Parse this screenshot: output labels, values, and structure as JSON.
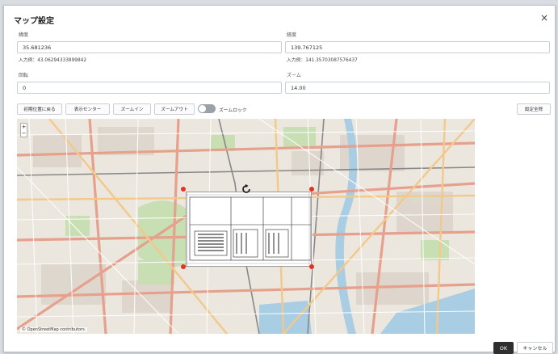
{
  "dialog": {
    "title": "マップ設定",
    "close_label": "×"
  },
  "fields": {
    "latitude": {
      "label": "緯度",
      "value": "35.681236",
      "hint": "入力例：43.06294333899842"
    },
    "longitude": {
      "label": "経度",
      "value": "139.767125",
      "hint": "入力例：141.35703087576437"
    },
    "rotation": {
      "label": "回転",
      "value": "0"
    },
    "zoom": {
      "label": "ズーム",
      "value": "14.00"
    }
  },
  "toolbar": {
    "reset_position": "初期位置に戻る",
    "display_center": "表示センター",
    "zoom_in": "ズームイン",
    "zoom_out": "ズームアウト",
    "zoom_lock_label": "ズームロック",
    "zoom_lock_on": false,
    "clear_settings": "設定全除"
  },
  "map": {
    "zoom_in_symbol": "+",
    "zoom_out_symbol": "−",
    "attribution": "© OpenStreetMap contributors."
  },
  "footer": {
    "ok_label": "OK",
    "cancel_label": "キャンセル"
  },
  "colors": {
    "handle": "#e53222",
    "ok_bg": "#2f2f2f",
    "toggle_off": "#9aa1a8"
  },
  "icons": [
    "close-icon",
    "rotate-icon",
    "toggle-switch",
    "zoom-plus-icon",
    "zoom-minus-icon"
  ]
}
